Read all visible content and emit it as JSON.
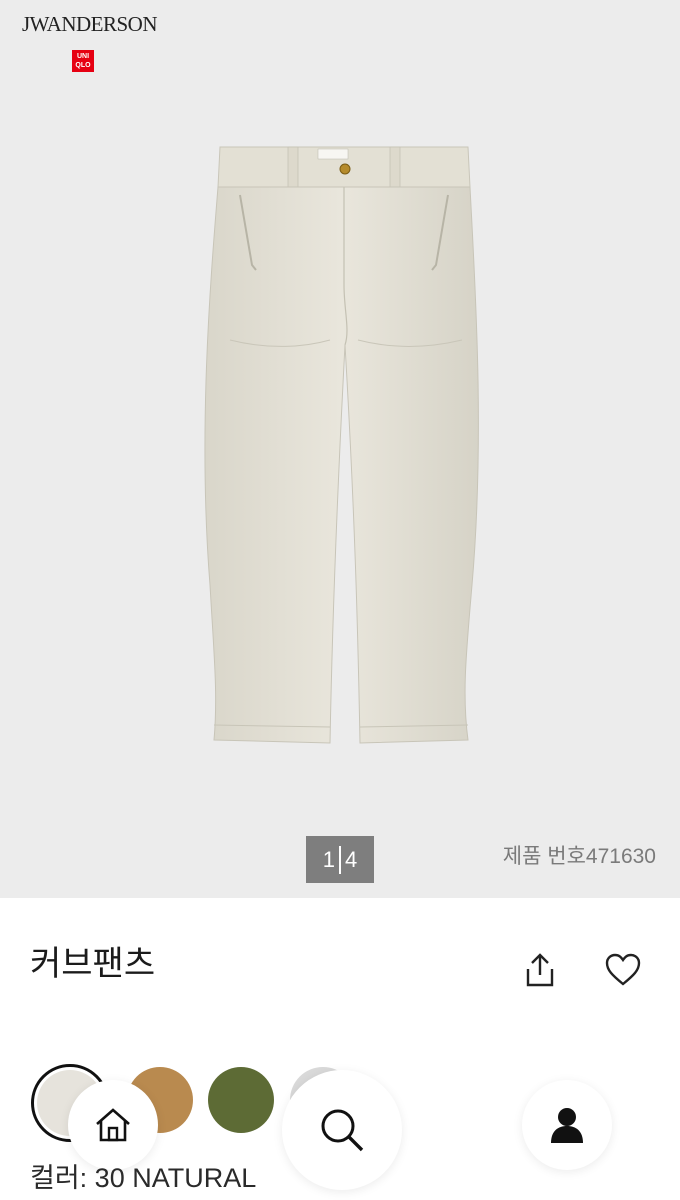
{
  "brand": {
    "collab_logo": "JWANDERSON",
    "store_logo": [
      "UNI",
      "QLO"
    ]
  },
  "gallery": {
    "current": "1",
    "total": "4",
    "product_number": "제품 번호471630"
  },
  "product": {
    "title": "커브팬츠",
    "color_label": "컬러: 30 NATURAL"
  },
  "actions": {
    "share_icon": "share-icon",
    "favorite_icon": "heart-icon"
  },
  "swatches": [
    {
      "name": "NATURAL",
      "color": "#e6e3dc",
      "selected": true
    },
    {
      "name": "BROWN",
      "color": "#b98a4f",
      "selected": false
    },
    {
      "name": "OLIVE",
      "color": "#5d6b35",
      "selected": false
    },
    {
      "name": "GRAY",
      "color": "#d6d6d6",
      "selected": false
    }
  ],
  "bottom_nav": {
    "home_icon": "home-icon",
    "search_icon": "search-icon",
    "profile_icon": "user-icon"
  },
  "colors": {
    "hero_bg": "#ececec",
    "pager_bg": "#7e7e7e",
    "uniqlo_red": "#e60012",
    "pants": "#e6e3d6"
  }
}
